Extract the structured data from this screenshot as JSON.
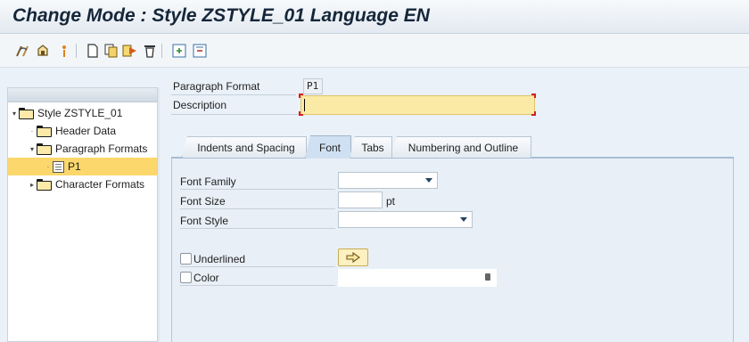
{
  "window": {
    "title": "Change Mode : Style ZSTYLE_01 Language EN"
  },
  "toolbar": {
    "buttons": [
      "display-change-icon",
      "other-object-icon",
      "info-icon",
      "create-icon",
      "copy-icon",
      "activate-icon",
      "delete-icon",
      "expand-icon",
      "collapse-icon"
    ]
  },
  "tree": {
    "items": [
      {
        "label": "Style ZSTYLE_01",
        "toggle": "▾",
        "icon": "open-folder-icon"
      },
      {
        "label": "Header Data",
        "toggle": "·",
        "icon": "folder-icon"
      },
      {
        "label": "Paragraph Formats",
        "toggle": "▾",
        "icon": "open-folder-icon"
      },
      {
        "label": "P1",
        "toggle": "·",
        "icon": "document-icon",
        "selected": true
      },
      {
        "label": "Character Formats",
        "toggle": "▸",
        "icon": "folder-icon"
      }
    ]
  },
  "form": {
    "paragraph_format_label": "Paragraph Format",
    "paragraph_format_value": "P1",
    "description_label": "Description",
    "description_value": ""
  },
  "tabs": [
    {
      "label": "Indents and Spacing",
      "active": false
    },
    {
      "label": "Font",
      "active": true
    },
    {
      "label": "Tabs",
      "active": false
    },
    {
      "label": "Numbering and Outline",
      "active": false
    }
  ],
  "font_tab": {
    "font_family_label": "Font Family",
    "font_family_value": "",
    "font_size_label": "Font Size",
    "font_size_value": "",
    "font_size_unit": "pt",
    "font_style_label": "Font Style",
    "font_style_value": "",
    "underlined_label": "Underlined",
    "underlined_checked": false,
    "color_label": "Color",
    "color_checked": false,
    "color_value": ""
  },
  "colors": {
    "title_text": "#15263a",
    "selected_row": "#fcd76b",
    "required_field": "#fbe9a6",
    "tab_panel": "#e8eff6"
  }
}
